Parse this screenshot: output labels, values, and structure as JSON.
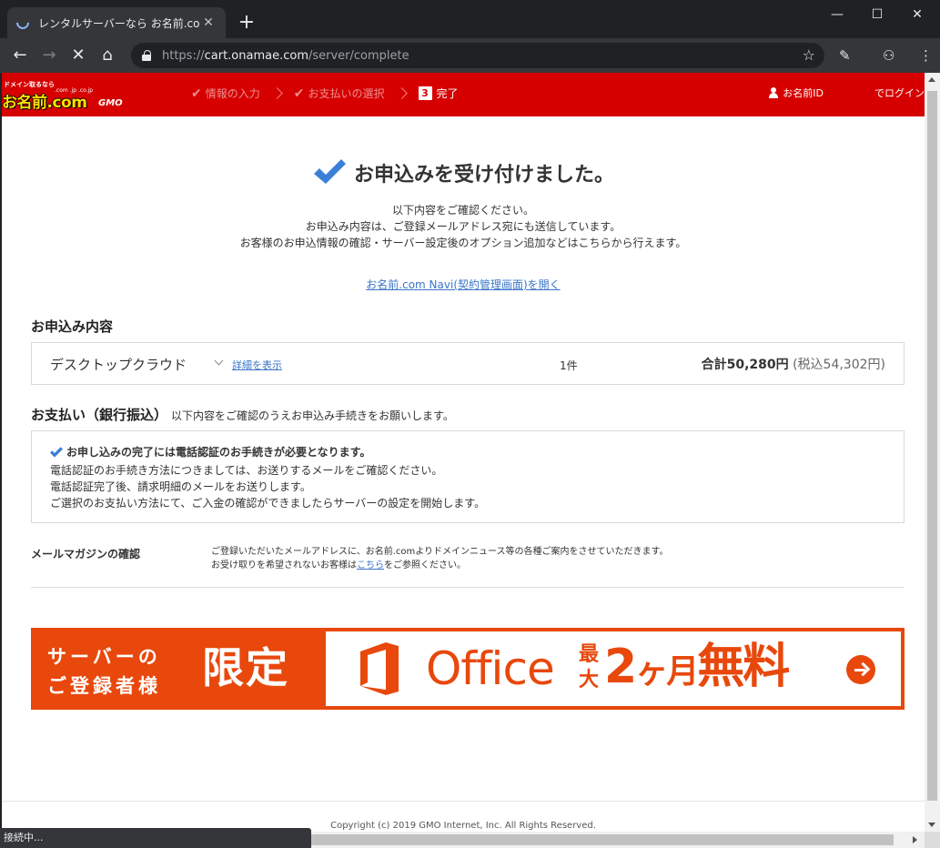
{
  "browser": {
    "tab_title": "レンタルサーバーなら お名前.com",
    "url_scheme": "https://",
    "url_host": "cart.onamae.com",
    "url_path": "/server/complete",
    "status": "接続中..."
  },
  "header": {
    "logo_top": "ドメイン取るなら",
    "logo_domains": ".com .jp .co.jp",
    "logo_main": "お名前.com",
    "logo_gmo": "GMO",
    "steps": [
      {
        "label": "情報の入力",
        "state": "done"
      },
      {
        "label": "お支払いの選択",
        "state": "done"
      },
      {
        "number": "3",
        "label": "完了",
        "state": "current"
      }
    ],
    "login_prefix": "お名前ID",
    "login_suffix": "でログイン"
  },
  "main": {
    "headline": "お申込みを受け付けました。",
    "intro_lines": [
      "以下内容をご確認ください。",
      "お申込み内容は、ご登録メールアドレス宛にも送信しています。",
      "お客様のお申込情報の確認・サーバー設定後のオプション追加などはこちらから行えます。"
    ],
    "navi_link": "お名前.com Navi(契約管理画面)を開く",
    "order": {
      "section_title": "お申込み内容",
      "product": "デスクトップクラウド",
      "detail_link": "詳細を表示",
      "quantity": "1件",
      "total_label": "合計",
      "total_amount": "50,280円",
      "tax_included": "(税込54,302円)"
    },
    "payment": {
      "section_title": "お支払い（銀行振込）",
      "section_note": "以下内容をご確認のうえお申込み手続きをお願いします。",
      "notice_head": "お申し込みの完了には電話認証のお手続きが必要となります。",
      "lines": [
        "電話認証のお手続き方法につきましては、お送りするメールをご確認ください。",
        "電話認証完了後、請求明細のメールをお送りします。",
        "ご選択のお支払い方法にて、ご入金の確認ができましたらサーバーの設定を開始します。"
      ]
    },
    "mail_magazine": {
      "label": "メールマガジンの確認",
      "line1": "ご登録いただいたメールアドレスに、お名前.comよりドメインニュース等の各種ご案内をさせていただきます。",
      "line2_prefix": "お受け取りを希望されないお客様は",
      "line2_link": "こちら",
      "line2_suffix": "をご参照ください。"
    },
    "banner": {
      "line1": "サーバーの",
      "line2": "ご登録者様",
      "limited": "限定",
      "office": "Office",
      "max": "最大",
      "months_num": "2",
      "months_unit": "ヶ月",
      "free": "無料"
    }
  },
  "footer": {
    "copyright": "Copyright (c) 2019 GMO Internet, Inc. All Rights Reserved."
  },
  "colors": {
    "brand_red": "#d60000",
    "office_orange": "#e8480c",
    "check_blue": "#3a7fd8",
    "link_blue": "#3a76c8"
  }
}
